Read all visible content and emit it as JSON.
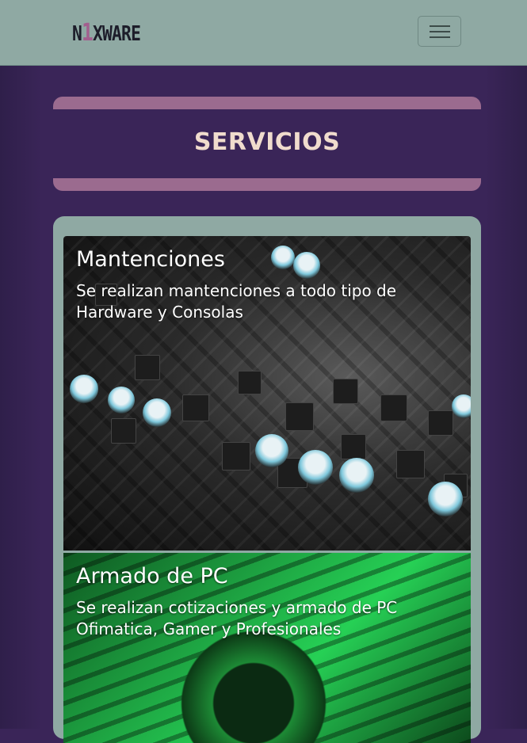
{
  "navbar": {
    "brand_prefix": "N",
    "brand_one": "1",
    "brand_suffix": "XWARE",
    "toggle_icon": "hamburger-menu-icon"
  },
  "page": {
    "title": "SERVICIOS"
  },
  "services": [
    {
      "title": "Mantenciones",
      "description": "Se realizan mantenciones a todo tipo de Hardware y Consolas",
      "image": "circuit-board-image"
    },
    {
      "title": "Armado de PC",
      "description": "Se realizan cotizaciones y armado de PC Ofimatica, Gamer y Profesionales",
      "image": "green-pc-components-image"
    }
  ],
  "colors": {
    "navbar_bg": "#8fa9a3",
    "page_bg": "#3a2558",
    "title_bar": "#9b6b8f",
    "title_text": "#f0dccd"
  }
}
